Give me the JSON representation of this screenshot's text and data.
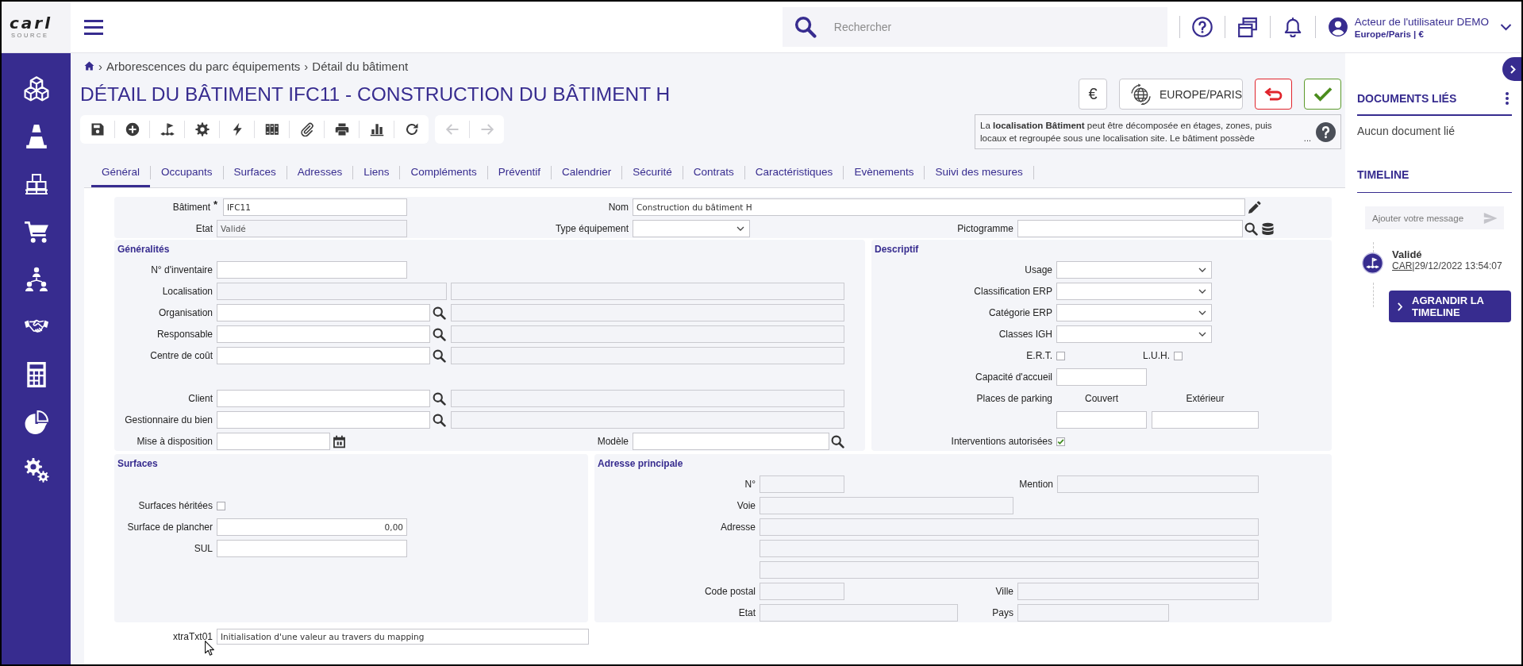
{
  "header": {
    "logo": {
      "name": "carl",
      "tagline": "SOURCE"
    },
    "search": {
      "placeholder": "Rechercher"
    },
    "user": {
      "name": "Acteur de l'utilisateur DEMO",
      "details": "Europe/Paris | €"
    }
  },
  "breadcrumb": [
    {
      "separator": "›",
      "label": "Arborescences du parc équipements"
    },
    {
      "separator": "›",
      "label": "Détail du bâtiment"
    }
  ],
  "title": "DÉTAIL DU BÂTIMENT IFC11 - CONSTRUCTION DU BÂTIMENT H",
  "navigation": [
    {
      "disabled": true
    },
    {
      "disabled": true
    }
  ],
  "actions": {
    "currency": "€",
    "timezone": "EUROPE/PARIS"
  },
  "info": {
    "text": "La **localisation Bâtiment** peut être décomposée en étages, zones, puis locaux et regroupée sous une localisation site. Le bâtiment possède",
    "more": "..."
  },
  "tabs": [
    {
      "label": "Général",
      "selected": true
    },
    {
      "label": "Occupants",
      "selected": false
    },
    {
      "label": "Surfaces",
      "selected": false
    },
    {
      "label": "Adresses",
      "selected": false
    },
    {
      "label": "Liens",
      "selected": false
    },
    {
      "label": "Compléments",
      "selected": false
    },
    {
      "label": "Préventif",
      "selected": false
    },
    {
      "label": "Calendrier",
      "selected": false
    },
    {
      "label": "Sécurité",
      "selected": false
    },
    {
      "label": "Contrats",
      "selected": false
    },
    {
      "label": "Caractéristiques",
      "selected": false
    },
    {
      "label": "Evènements",
      "selected": false
    },
    {
      "label": "Suivi des mesures",
      "selected": false
    }
  ],
  "form": {
    "header": {
      "building": {
        "label": "Bâtiment",
        "required_mark": "*",
        "value": "IFC11",
        "readonly": false
      },
      "name": {
        "label": "Nom",
        "value": "Construction du bâtiment H",
        "readonly": false
      },
      "status": {
        "label": "Etat",
        "value": "Validé",
        "readonly": true
      },
      "equipment_type": {
        "label": "Type équipement"
      },
      "pictogram": {
        "label": "Pictogramme",
        "readonly": false
      }
    },
    "general": {
      "title": "Généralités",
      "inventory_number": {
        "label": "N° d'inventaire",
        "readonly": false
      },
      "location": {
        "label": "Localisation",
        "readonly": true
      },
      "organisation": {
        "label": "Organisation",
        "readonly": false
      },
      "manager": {
        "label": "Responsable",
        "readonly": false
      },
      "cost_center": {
        "label": "Centre de coût",
        "readonly": false
      },
      "client": {
        "label": "Client",
        "readonly": false
      },
      "property_manager": {
        "label": "Gestionnaire du bien",
        "readonly": false
      },
      "availability_date": {
        "label": "Mise à disposition",
        "readonly": false
      },
      "model": {
        "label": "Modèle",
        "readonly": false
      }
    },
    "descriptive": {
      "title": "Descriptif",
      "usage": {
        "label": "Usage"
      },
      "erp_classification": {
        "label": "Classification ERP"
      },
      "erp_category": {
        "label": "Catégorie ERP"
      },
      "igh_classes": {
        "label": "Classes IGH"
      },
      "ert": {
        "label": "E.R.T.",
        "checked": false
      },
      "luh": {
        "label": "L.U.H.",
        "checked": false
      },
      "capacity": {
        "label": "Capacité d'accueil",
        "readonly": false
      },
      "parking": {
        "label": "Places de parking",
        "covered": "Couvert",
        "outdoor": "Extérieur",
        "readonly": false
      },
      "interventions": {
        "label": "Interventions autorisées",
        "checked": true
      }
    },
    "surfaces": {
      "title": "Surfaces",
      "inherited": {
        "label": "Surfaces héritées",
        "checked": false
      },
      "floor_area": {
        "label": "Surface de plancher",
        "value": "0,00",
        "readonly": false
      },
      "sul": {
        "label": "SUL",
        "readonly": false
      }
    },
    "address": {
      "title": "Adresse principale",
      "number": {
        "label": "N°",
        "readonly": true
      },
      "mention": {
        "label": "Mention",
        "readonly": true
      },
      "street": {
        "label": "Voie",
        "readonly": true
      },
      "address": {
        "label": "Adresse",
        "readonly": true
      },
      "postal_code": {
        "label": "Code postal",
        "readonly": true
      },
      "city": {
        "label": "Ville",
        "readonly": true
      },
      "state": {
        "label": "Etat",
        "readonly": true
      },
      "country": {
        "label": "Pays",
        "readonly": true
      }
    },
    "extra": {
      "label": "xtraTxt01",
      "value": "Initialisation d'une valeur au travers du mapping",
      "readonly": false
    }
  },
  "side_panel": {
    "documents": {
      "title": "DOCUMENTS LIÉS",
      "empty_text": "Aucun document lié"
    },
    "timeline": {
      "title": "TIMELINE",
      "message_placeholder": "Ajouter votre message",
      "events": [
        {
          "title": "Validé",
          "user": "CAR",
          "separator": "|",
          "date": "29/12/2022 13:54:07"
        }
      ],
      "expand_button": "AGRANDIR LA TIMELINE"
    }
  }
}
